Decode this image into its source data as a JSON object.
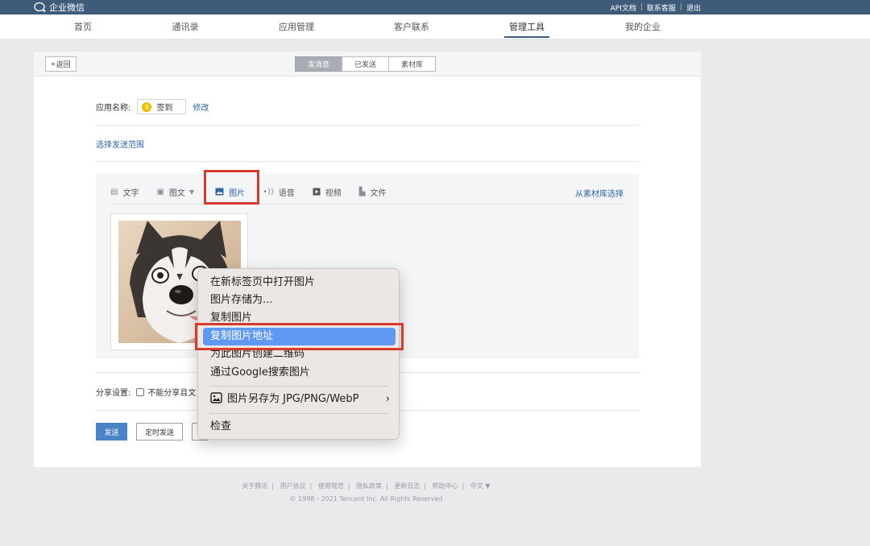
{
  "topbar": {
    "brand": "企业微信",
    "links": [
      "API文档",
      "联系客服",
      "退出"
    ]
  },
  "nav": {
    "items": [
      "首页",
      "通讯录",
      "应用管理",
      "客户联系",
      "管理工具",
      "我的企业"
    ],
    "active": "管理工具"
  },
  "panel": {
    "back_label": "返回",
    "tabs": [
      "发消息",
      "已发送",
      "素材库"
    ],
    "active_tab": "发消息",
    "app_name_label": "应用名称:",
    "app_name": "签到",
    "app_icon_glyph": "$",
    "edit_label": "修改",
    "scope_label": "选择发送范围",
    "editor": {
      "tools": [
        {
          "label": "文字",
          "icon": "text-icon"
        },
        {
          "label": "图文",
          "icon": "article-icon"
        },
        {
          "label": "图片",
          "icon": "image-icon"
        },
        {
          "label": "语音",
          "icon": "voice-icon"
        },
        {
          "label": "视频",
          "icon": "video-icon"
        },
        {
          "label": "文件",
          "icon": "file-icon"
        }
      ],
      "active_tool": "图片",
      "library_link": "从素材库选择",
      "image_alt": "husky photo"
    },
    "share_label": "分享设置:",
    "share_option": "不能分享且文",
    "send_label": "发送",
    "schedule_label": "定时发送"
  },
  "context_menu": {
    "items": [
      "在新标签页中打开图片",
      "图片存储为...",
      "复制图片",
      "复制图片地址",
      "为此图片创建二维码",
      "通过Google搜索图片"
    ],
    "selected": "复制图片地址",
    "save_as": "图片另存为 JPG/PNG/WebP",
    "inspect": "检查"
  },
  "footer": {
    "links": [
      "关于腾讯",
      "用户协议",
      "使用规范",
      "隐私政策",
      "更新日志",
      "帮助中心",
      "中文 ▼"
    ],
    "copyright": "© 1998 - 2021 Tencent Inc. All Rights Reserved"
  },
  "colors": {
    "topbar": "#3f5b7a",
    "link": "#2f66a8",
    "primary_button": "#4b83c8",
    "highlight": "#d63a2a",
    "menu_selection": "#5f99f4"
  }
}
